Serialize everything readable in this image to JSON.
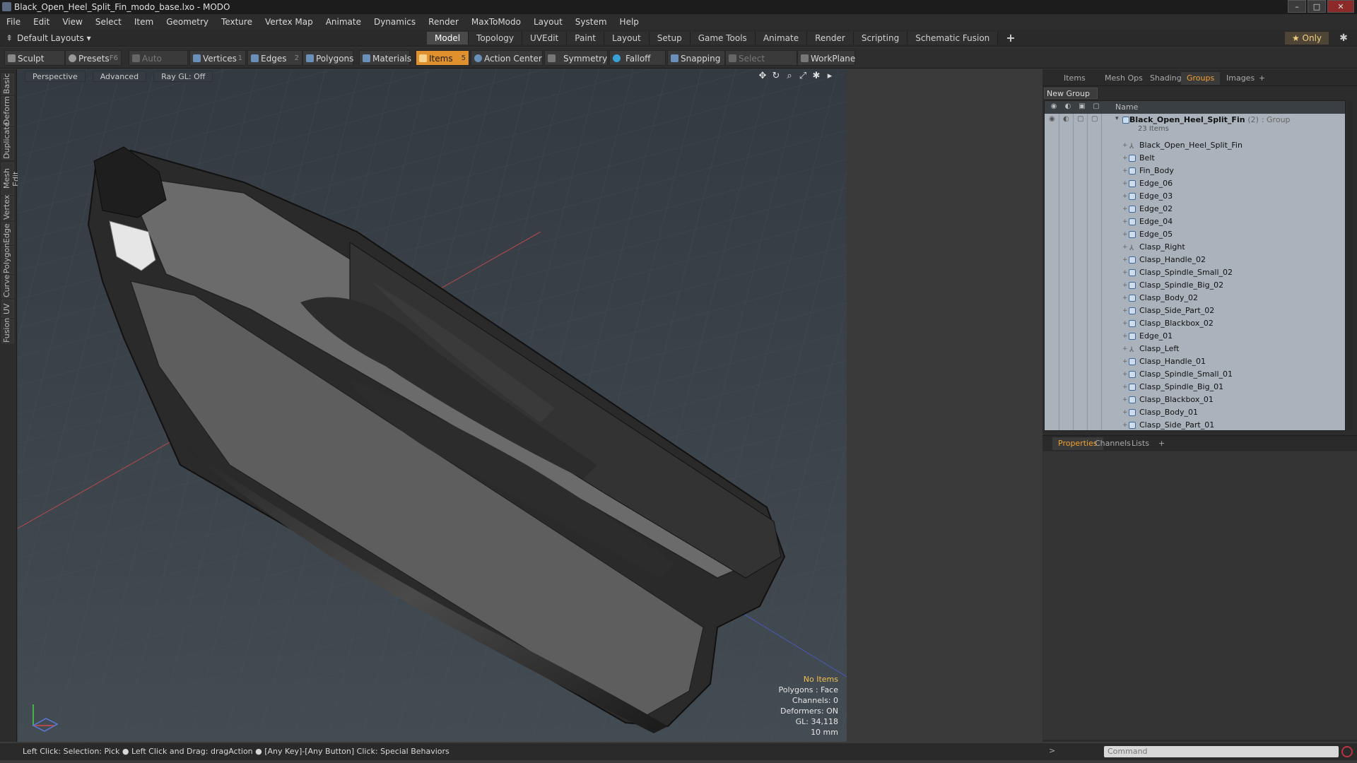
{
  "window": {
    "title": "Black_Open_Heel_Split_Fin_modo_base.lxo - MODO",
    "min": "–",
    "max": "□",
    "close": "✕"
  },
  "menu": [
    "File",
    "Edit",
    "View",
    "Select",
    "Item",
    "Geometry",
    "Texture",
    "Vertex Map",
    "Animate",
    "Dynamics",
    "Render",
    "MaxToModo",
    "Layout",
    "System",
    "Help"
  ],
  "layout": {
    "selector": "Default Layouts ▾",
    "only": "★ Only",
    "gear": "✱"
  },
  "tabs": [
    "Model",
    "Topology",
    "UVEdit",
    "Paint",
    "Layout",
    "Setup",
    "Game Tools",
    "Animate",
    "Render",
    "Scripting",
    "Schematic Fusion"
  ],
  "tabs_plus": "+",
  "toolbar": {
    "sculpt": "Sculpt",
    "presets": "Presets",
    "presets_key": "F6",
    "auto_select": "Auto Select",
    "vertices": "Vertices",
    "vertices_key": "1",
    "edges": "Edges",
    "edges_key": "2",
    "polygons": "Polygons",
    "materials": "Materials",
    "items": "Items",
    "items_key": "5",
    "action_center": "Action Center",
    "symmetry": "Symmetry",
    "falloff": "Falloff",
    "snapping": "Snapping",
    "select_through": "Select Through",
    "workplane": "WorkPlane"
  },
  "sidetabs": [
    "Basic",
    "Deform",
    "Duplicate",
    "Mesh Edit",
    "Vertex",
    "Edge",
    "Polygon",
    "Curve",
    "UV",
    "Fusion"
  ],
  "viewport": {
    "view": "Perspective",
    "shading": "Advanced",
    "raygl": "Ray GL: Off",
    "info": {
      "no_items": "No Items",
      "polygons": "Polygons : Face",
      "channels": "Channels: 0",
      "deformers": "Deformers: ON",
      "gl": "GL: 34,118",
      "scale": "10 mm"
    }
  },
  "status": "Left Click: Selection: Pick ● Left Click and Drag: dragAction ● [Any Key]-[Any Button] Click: Special Behaviors",
  "panel_tabs": [
    "Items",
    "Mesh Ops",
    "Shading",
    "Groups",
    "Images"
  ],
  "panel_tabs_plus": "+",
  "new_group": "New Group",
  "list_header": "Name",
  "group": {
    "name": "Black_Open_Heel_Split_Fin",
    "count": "(2)",
    "type": ": Group",
    "sub": "23 Items"
  },
  "items": [
    {
      "name": "Black_Open_Heel_Split_Fin",
      "kind": "locator"
    },
    {
      "name": "Belt",
      "kind": "mesh"
    },
    {
      "name": "Fin_Body",
      "kind": "mesh"
    },
    {
      "name": "Edge_06",
      "kind": "mesh"
    },
    {
      "name": "Edge_03",
      "kind": "mesh"
    },
    {
      "name": "Edge_02",
      "kind": "mesh"
    },
    {
      "name": "Edge_04",
      "kind": "mesh"
    },
    {
      "name": "Edge_05",
      "kind": "mesh"
    },
    {
      "name": "Clasp_Right",
      "kind": "locator"
    },
    {
      "name": "Clasp_Handle_02",
      "kind": "mesh"
    },
    {
      "name": "Clasp_Spindle_Small_02",
      "kind": "mesh"
    },
    {
      "name": "Clasp_Spindle_Big_02",
      "kind": "mesh"
    },
    {
      "name": "Clasp_Body_02",
      "kind": "mesh"
    },
    {
      "name": "Clasp_Side_Part_02",
      "kind": "mesh"
    },
    {
      "name": "Clasp_Blackbox_02",
      "kind": "mesh"
    },
    {
      "name": "Edge_01",
      "kind": "mesh"
    },
    {
      "name": "Clasp_Left",
      "kind": "locator"
    },
    {
      "name": "Clasp_Handle_01",
      "kind": "mesh"
    },
    {
      "name": "Clasp_Spindle_Small_01",
      "kind": "mesh"
    },
    {
      "name": "Clasp_Spindle_Big_01",
      "kind": "mesh"
    },
    {
      "name": "Clasp_Blackbox_01",
      "kind": "mesh"
    },
    {
      "name": "Clasp_Body_01",
      "kind": "mesh"
    },
    {
      "name": "Clasp_Side_Part_01",
      "kind": "mesh"
    }
  ],
  "prop_tabs": [
    "Properties",
    "Channels",
    "Lists"
  ],
  "prop_tabs_plus": "+",
  "command": {
    "placeholder": "Command",
    "arrow": ">"
  }
}
